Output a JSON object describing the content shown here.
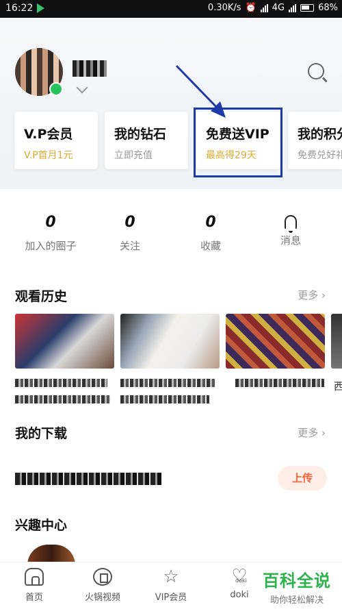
{
  "status_bar": {
    "time": "16:22",
    "speed": "0.30K/s",
    "network": "4G",
    "battery": "68%"
  },
  "cards": [
    {
      "title": "V.P会员",
      "subtitle": "V.P首月1元"
    },
    {
      "title": "我的钻石",
      "subtitle": "立即充值"
    },
    {
      "title": "免费送VIP",
      "subtitle": "最高得29天"
    },
    {
      "title": "我的积分",
      "subtitle": "免费兑好礼"
    }
  ],
  "stats": [
    {
      "value": "0",
      "label": "加入的圈子"
    },
    {
      "value": "0",
      "label": "关注"
    },
    {
      "value": "0",
      "label": "收藏"
    },
    {
      "label": "消息",
      "icon": "bell-icon"
    }
  ],
  "history": {
    "title": "观看历史",
    "more": "更多",
    "next_caption_start": "西"
  },
  "downloads": {
    "title": "我的下载",
    "more": "更多",
    "upload_button": "上传"
  },
  "interests": {
    "title": "兴趣中心"
  },
  "nav": [
    {
      "label": "首页",
      "icon": "home-icon"
    },
    {
      "label": "火锅视频",
      "icon": "film-icon"
    },
    {
      "label": "VIP会员",
      "icon": "star-icon"
    },
    {
      "label": "doki",
      "icon": "heart-icon",
      "tag": "doki"
    }
  ],
  "watermark": {
    "main": "百科全说",
    "sub": "助你轻松解决"
  },
  "colors": {
    "highlight_box": "#1e3aa8",
    "gold": "#e0a930",
    "upload": "#f0623a",
    "watermark": "#2bb24c"
  }
}
